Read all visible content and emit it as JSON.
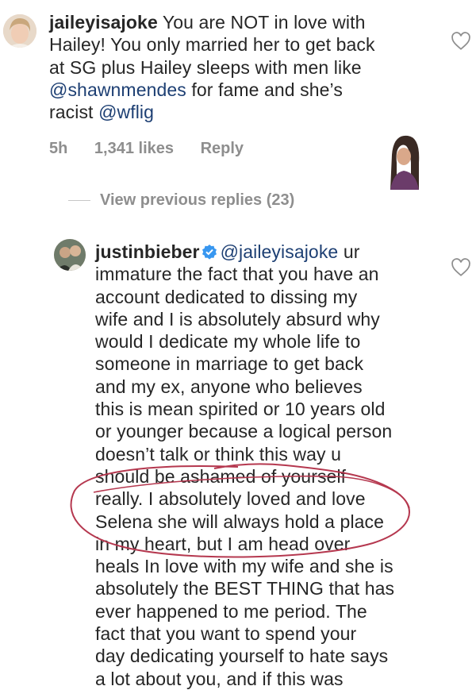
{
  "comment1": {
    "username": "jaileyisajoke",
    "lines": [
      "You are NOT in love with",
      "Hailey! You only married her to get back",
      "at SG plus Hailey sleeps with men like",
      "for fame and she’s",
      "racist"
    ],
    "mention_shawn": "@shawnmendes",
    "mention_wflig": "@wflig",
    "time": "5h",
    "likes": "1,341 likes",
    "reply": "Reply"
  },
  "view_previous": "View previous replies (23)",
  "comment2": {
    "username": "justinbieber",
    "mention": "@jaileyisajoke",
    "first_line_tail": "ur",
    "lines": [
      "immature the fact that you have an",
      "account dedicated to dissing my",
      "wife and I is absolutely absurd why",
      "would I dedicate my whole life to",
      "someone in marriage to get back",
      "and my ex, anyone who believes",
      "this is mean spirited or 10 years old",
      "or younger because a logical person",
      "doesn’t talk or think this way u",
      "should be ashamed of yourself",
      "really.  I absolutely loved and love",
      "Selena she will always hold a place",
      "in my heart, but I am head over",
      "heals In love with my wife and she is",
      "absolutely the BEST THING that has",
      "ever happened to me period. The",
      "fact that you want to spend your",
      "day dedicating yourself to hate says",
      "a lot about you, and if this was"
    ]
  },
  "icons": {
    "heart": "heart-outline-icon",
    "verified": "verified-badge-icon"
  },
  "colors": {
    "text": "#262626",
    "meta": "#8e8e8e",
    "mention": "#1d3f73",
    "verified": "#3897f0",
    "annotation": "#b5384f"
  }
}
